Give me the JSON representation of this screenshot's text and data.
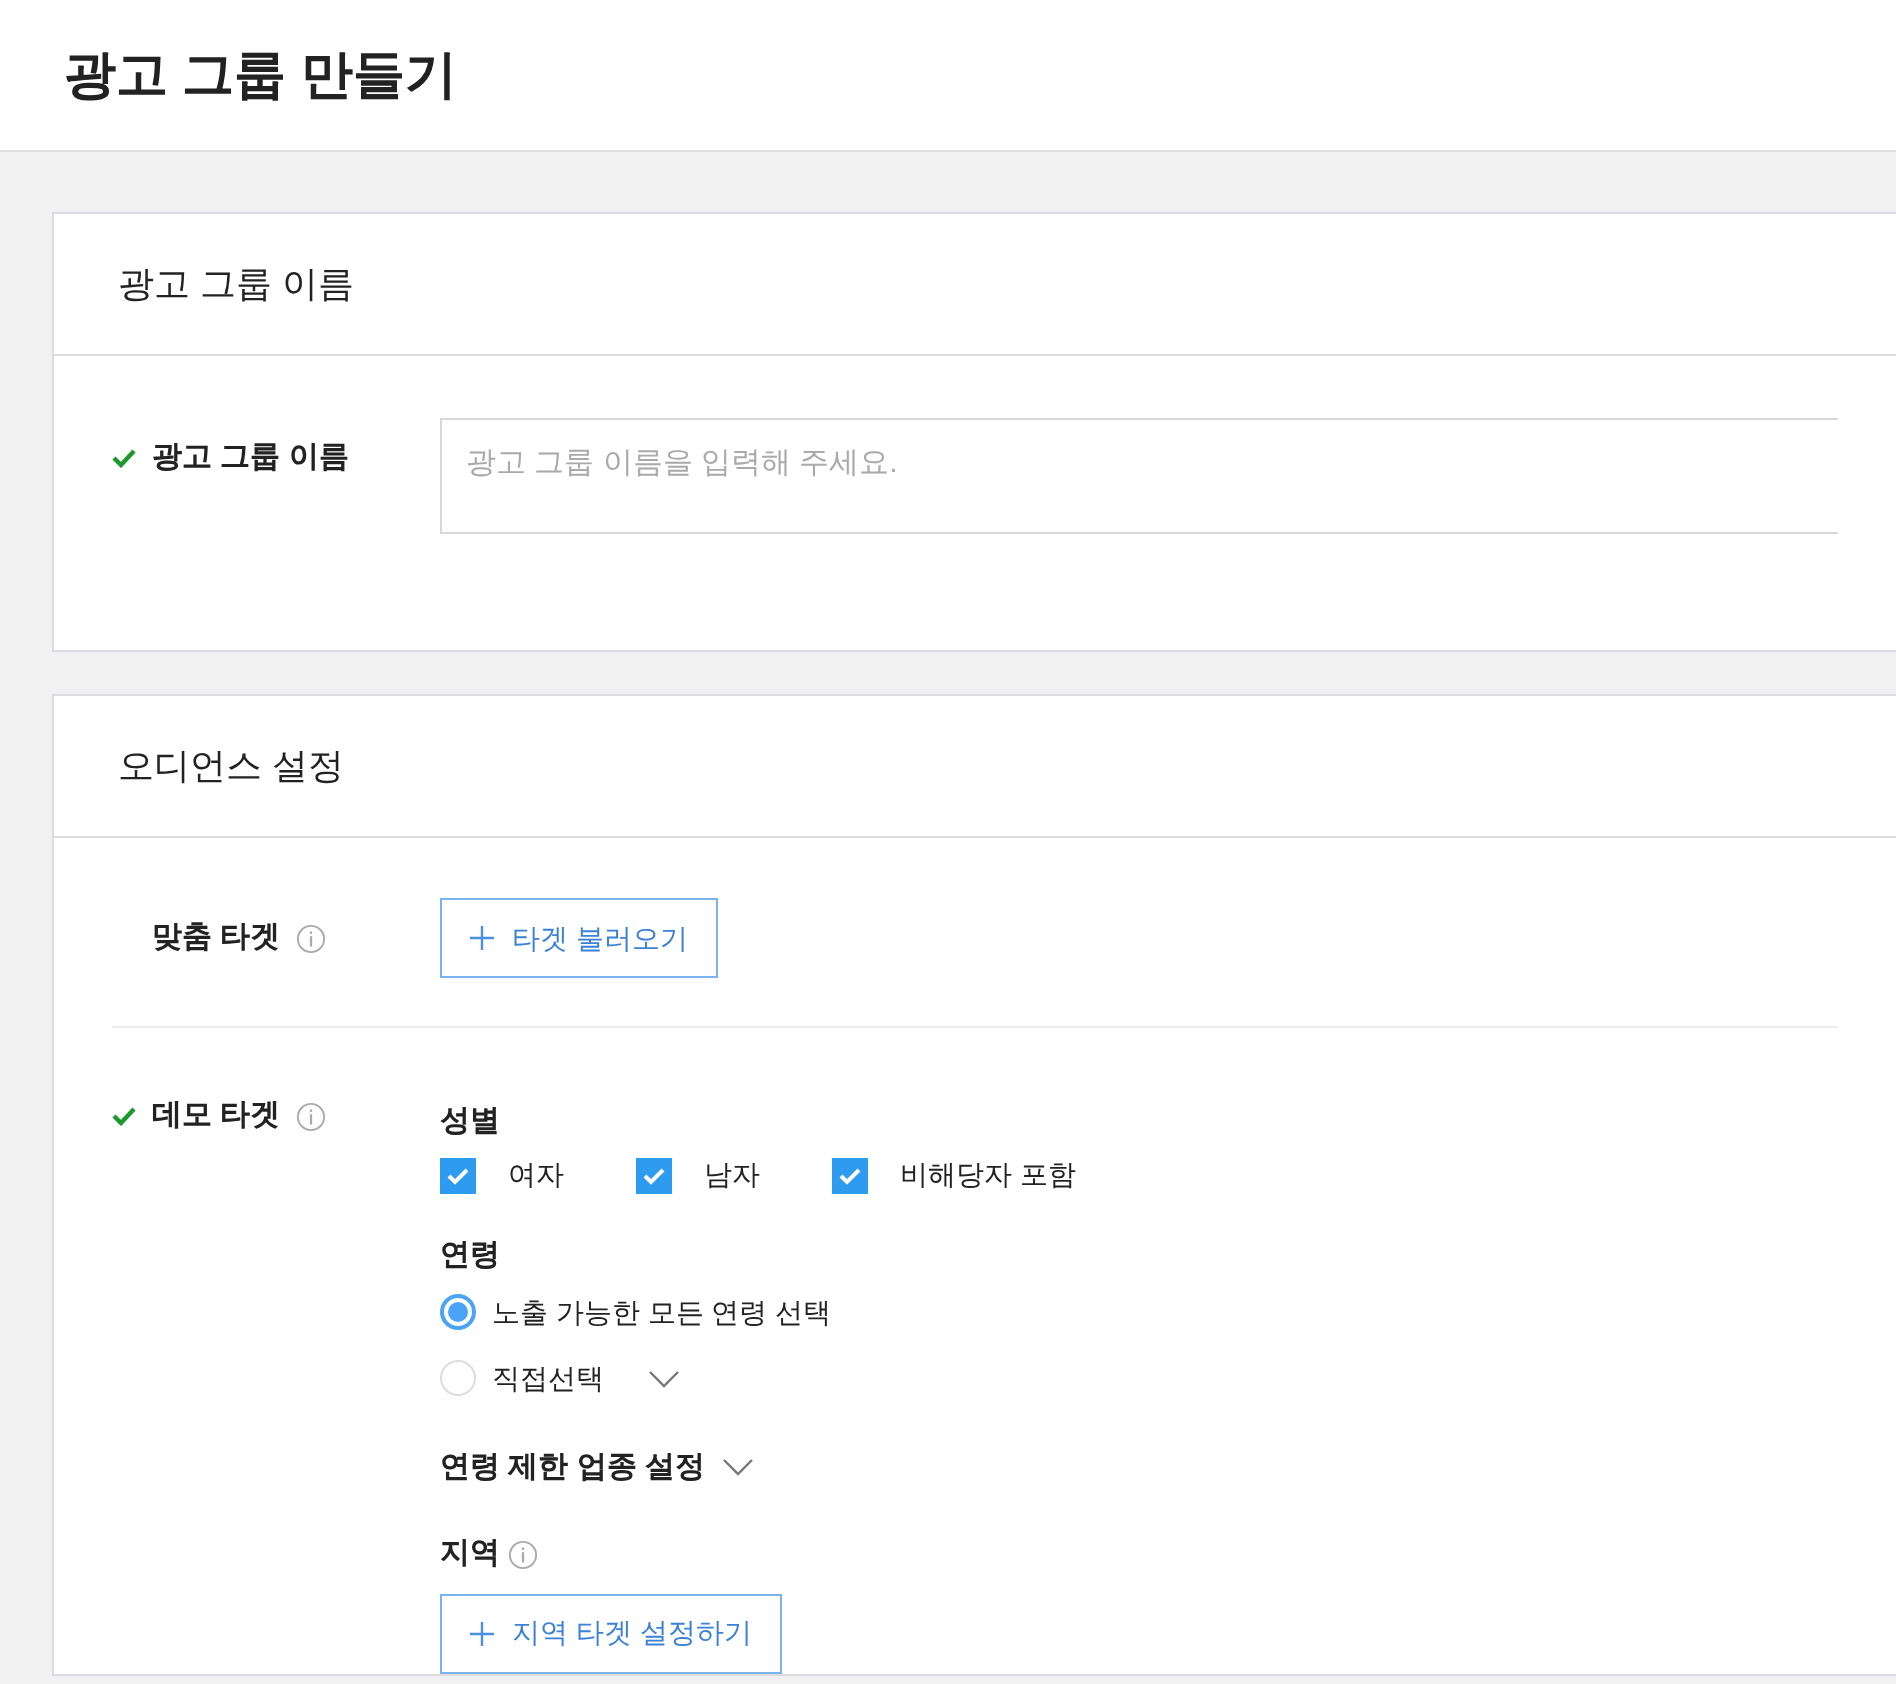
{
  "page": {
    "title": "광고 그룹 만들기"
  },
  "name_section": {
    "title": "광고 그룹 이름",
    "label": "광고 그룹 이름",
    "valid": true,
    "info": false,
    "placeholder": "광고 그룹 이름을 입력해 주세요."
  },
  "audience_section": {
    "title": "오디언스 설정",
    "custom_target": {
      "label": "맞춤 타겟",
      "valid": false,
      "info": true,
      "button": "타겟 불러오기"
    },
    "demo_target": {
      "label": "데모 타겟",
      "valid": true,
      "info": true,
      "gender": {
        "title": "성별",
        "options": [
          {
            "label": "여자",
            "checked": true
          },
          {
            "label": "남자",
            "checked": true
          },
          {
            "label": "비해당자 포함",
            "checked": true
          }
        ]
      },
      "age": {
        "title": "연령",
        "options": [
          {
            "label": "노출 가능한 모든 연령 선택",
            "selected": true,
            "dropdown": false
          },
          {
            "label": "직접선택",
            "selected": false,
            "dropdown": true
          }
        ]
      },
      "age_restriction": {
        "label": "연령 제한 업종 설정",
        "expanded": false
      },
      "region": {
        "title": "지역",
        "info": true,
        "button": "지역 타겟 설정하기"
      }
    }
  }
}
